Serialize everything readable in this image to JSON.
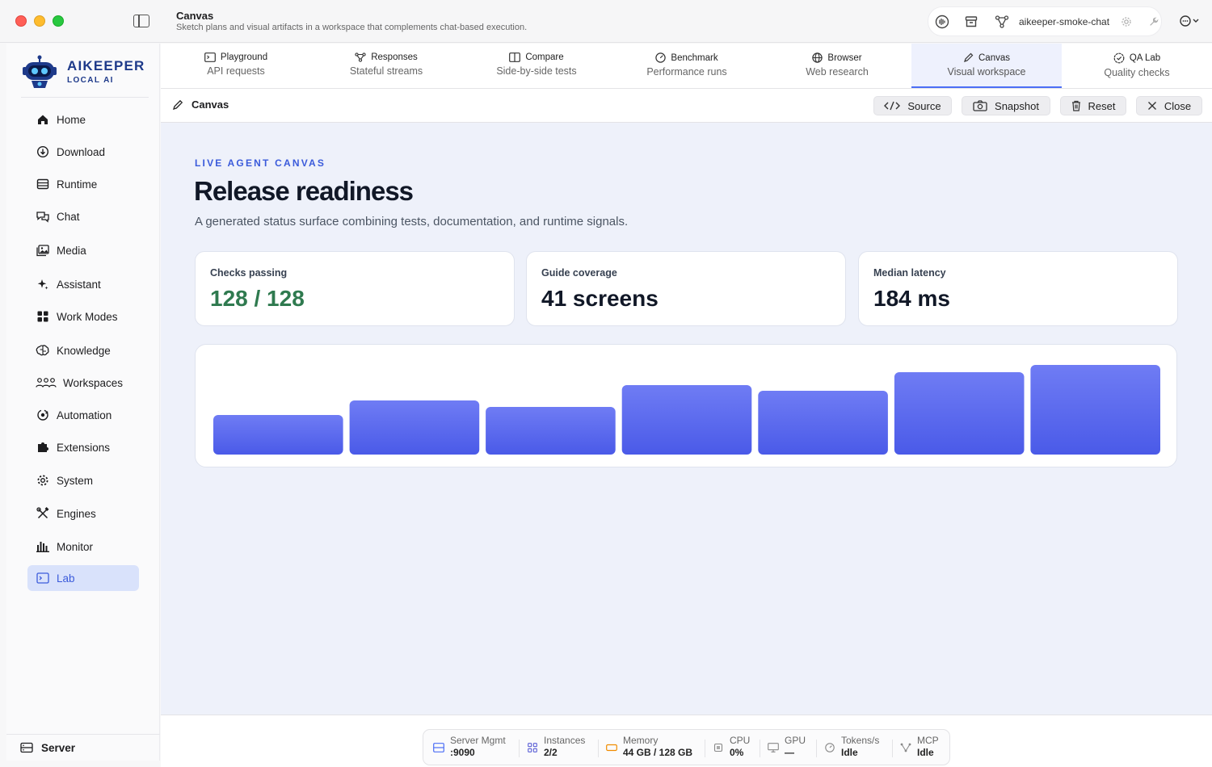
{
  "window": {
    "title": "Canvas",
    "subtitle": "Sketch plans and visual artifacts in a workspace that complements chat-based execution.",
    "model_name": "aikeeper-smoke-chat"
  },
  "brand": {
    "name": "AIKEEPER",
    "tagline": "LOCAL AI"
  },
  "sidebar": {
    "items": [
      {
        "label": "Home",
        "icon": "home-icon"
      },
      {
        "label": "Download",
        "icon": "download-icon"
      },
      {
        "label": "Runtime",
        "icon": "runtime-icon"
      },
      {
        "label": "Chat",
        "icon": "chat-icon"
      },
      {
        "label": "Media",
        "icon": "media-icon"
      },
      {
        "label": "Assistant",
        "icon": "sparkle-icon"
      },
      {
        "label": "Work Modes",
        "icon": "grid-icon"
      },
      {
        "label": "Knowledge",
        "icon": "brain-icon"
      },
      {
        "label": "Workspaces",
        "icon": "people-icon"
      },
      {
        "label": "Automation",
        "icon": "automation-icon"
      },
      {
        "label": "Extensions",
        "icon": "puzzle-icon"
      },
      {
        "label": "System",
        "icon": "gear-icon"
      },
      {
        "label": "Engines",
        "icon": "tools-icon"
      },
      {
        "label": "Monitor",
        "icon": "bars-icon"
      },
      {
        "label": "Lab",
        "icon": "terminal-icon"
      }
    ],
    "active": "Lab",
    "footer": "Server"
  },
  "tabs": [
    {
      "title": "Playground",
      "sub": "API requests"
    },
    {
      "title": "Responses",
      "sub": "Stateful streams"
    },
    {
      "title": "Compare",
      "sub": "Side-by-side tests"
    },
    {
      "title": "Benchmark",
      "sub": "Performance runs"
    },
    {
      "title": "Browser",
      "sub": "Web research"
    },
    {
      "title": "Canvas",
      "sub": "Visual workspace"
    },
    {
      "title": "QA Lab",
      "sub": "Quality checks"
    }
  ],
  "active_tab": "Canvas",
  "canvas_header": {
    "title": "Canvas",
    "source": "Source",
    "snapshot": "Snapshot",
    "reset": "Reset",
    "close": "Close"
  },
  "canvas": {
    "eyebrow": "LIVE AGENT CANVAS",
    "headline": "Release readiness",
    "lede": "A generated status surface combining tests, documentation, and runtime signals.",
    "stats": [
      {
        "label": "Checks passing",
        "value": "128 / 128"
      },
      {
        "label": "Guide coverage",
        "value": "41 screens"
      },
      {
        "label": "Median latency",
        "value": "184 ms"
      }
    ]
  },
  "chart_data": {
    "type": "bar",
    "categories": [],
    "values": [
      49,
      67,
      59,
      86,
      79,
      102,
      111
    ],
    "ylim": [
      0,
      111
    ],
    "colors": {
      "top": "#6f7cf4",
      "bottom": "#4a5ae8"
    }
  },
  "statusbar": [
    {
      "label": "Server Mgmt",
      "value": ":9090",
      "icon": "server-icon"
    },
    {
      "label": "Instances",
      "value": "2/2",
      "icon": "instances-icon"
    },
    {
      "label": "Memory",
      "value": "44 GB / 128 GB",
      "icon": "memory-icon"
    },
    {
      "label": "CPU",
      "value": "0%",
      "icon": "cpu-icon"
    },
    {
      "label": "GPU",
      "value": "—",
      "icon": "gpu-icon"
    },
    {
      "label": "Tokens/s",
      "value": "Idle",
      "icon": "gauge-icon"
    },
    {
      "label": "MCP",
      "value": "Idle",
      "icon": "mcp-icon"
    }
  ],
  "colors": {
    "accent": "#4c6ef5",
    "success": "#2f7a4f",
    "brand": "#1e3a8a"
  }
}
